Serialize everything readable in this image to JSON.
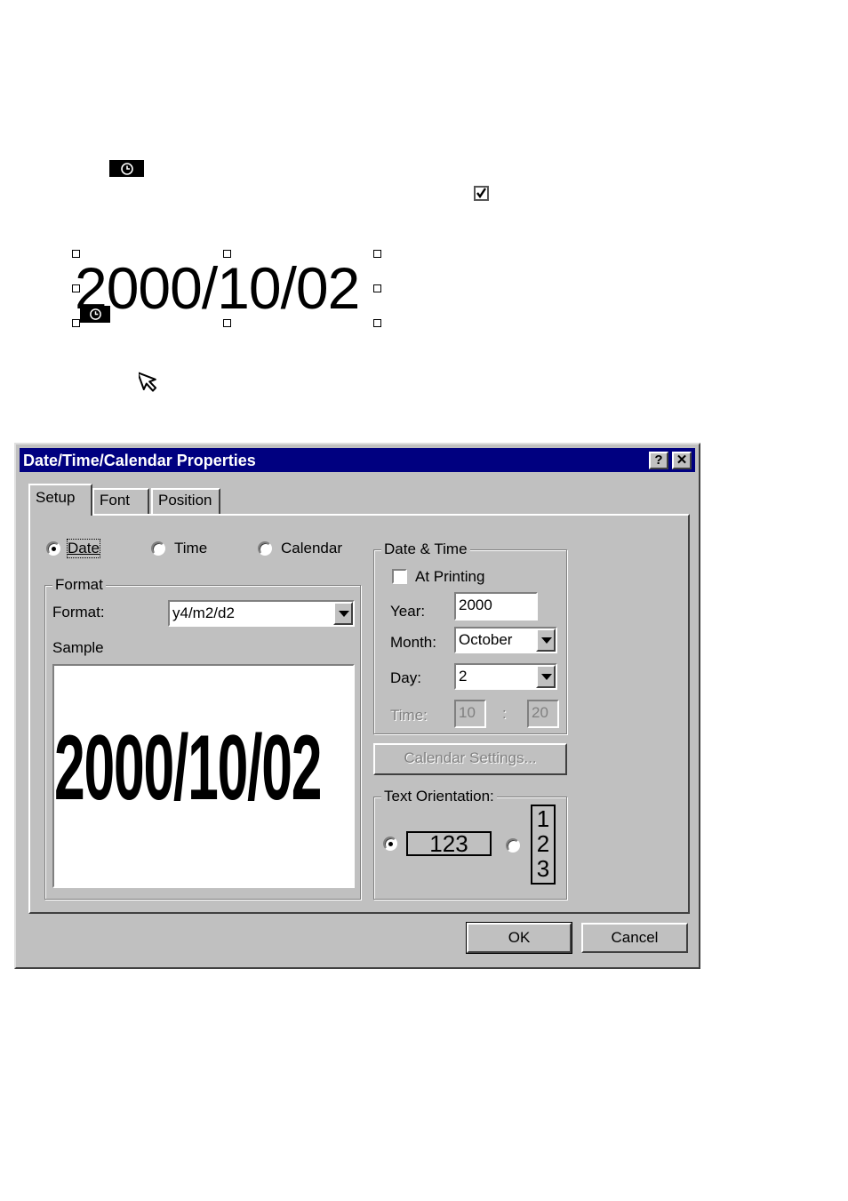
{
  "illustration": {
    "date_text": "2000/10/02"
  },
  "dialog": {
    "title": "Date/Time/Calendar Properties",
    "help_label": "?",
    "close_label": "✕",
    "tabs": [
      {
        "label": "Setup",
        "active": true
      },
      {
        "label": "Font",
        "active": false
      },
      {
        "label": "Position",
        "active": false
      }
    ],
    "type_options": [
      {
        "label": "Date",
        "selected": true
      },
      {
        "label": "Time",
        "selected": false
      },
      {
        "label": "Calendar",
        "selected": false
      }
    ],
    "format_group": {
      "legend": "Format",
      "format_label": "Format:",
      "format_value": "y4/m2/d2",
      "sample_label": "Sample",
      "sample_text": "2000/10/02"
    },
    "datetime_group": {
      "legend": "Date & Time",
      "at_printing_label": "At Printing",
      "at_printing_checked": false,
      "year_label": "Year:",
      "year_value": "2000",
      "month_label": "Month:",
      "month_value": "October",
      "day_label": "Day:",
      "day_value": "2",
      "time_label": "Time:",
      "time_hour": "10",
      "time_sep": ":",
      "time_minute": "20"
    },
    "calendar_settings_label": "Calendar Settings...",
    "orientation_group": {
      "legend": "Text Orientation:",
      "horizontal_sample": "123",
      "vertical_sample": [
        "1",
        "2",
        "3"
      ],
      "selected": "horizontal"
    },
    "ok_label": "OK",
    "cancel_label": "Cancel"
  }
}
